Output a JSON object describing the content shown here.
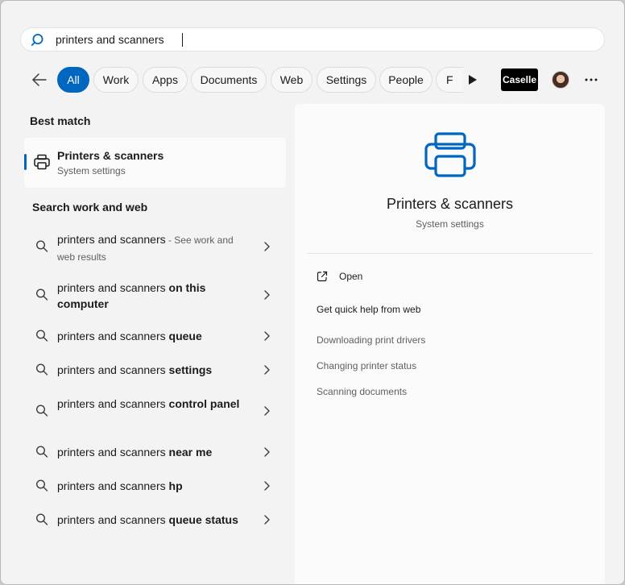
{
  "search": {
    "value": "printers and scanners"
  },
  "filters": [
    "All",
    "Work",
    "Apps",
    "Documents",
    "Web",
    "Settings",
    "People",
    "F"
  ],
  "account_badge": "Caselle",
  "best_match": {
    "heading": "Best match",
    "title": "Printers & scanners",
    "subtitle": "System settings"
  },
  "search_web": {
    "heading": "Search work and web",
    "results": [
      {
        "base": "printers and scanners",
        "suffix": "",
        "note": " - See work and web results"
      },
      {
        "base": "printers and scanners",
        "suffix": " on this computer",
        "note": ""
      },
      {
        "base": "printers and scanners",
        "suffix": " queue",
        "note": ""
      },
      {
        "base": "printers and scanners",
        "suffix": " settings",
        "note": ""
      },
      {
        "base": "printers and scanners",
        "suffix": " control panel",
        "note": ""
      },
      {
        "base": "printers and scanners",
        "suffix": " near me",
        "note": ""
      },
      {
        "base": "printers and scanners",
        "suffix": " hp",
        "note": ""
      },
      {
        "base": "printers and scanners",
        "suffix": " queue status",
        "note": ""
      }
    ]
  },
  "preview": {
    "title": "Printers & scanners",
    "subtitle": "System settings",
    "open_label": "Open",
    "help_heading": "Get quick help from web",
    "help_links": [
      "Downloading print drivers",
      "Changing printer status",
      "Scanning documents"
    ]
  },
  "colors": {
    "accent": "#0067c0",
    "background": "#f3f3f3",
    "panel": "#fbfbfb"
  },
  "icons": {
    "search": "search-icon",
    "back": "arrow-left-icon",
    "printer": "printer-icon",
    "chevron": "chevron-right-icon",
    "open": "open-external-icon",
    "more": "more-horizontal-icon",
    "play": "play-icon"
  }
}
